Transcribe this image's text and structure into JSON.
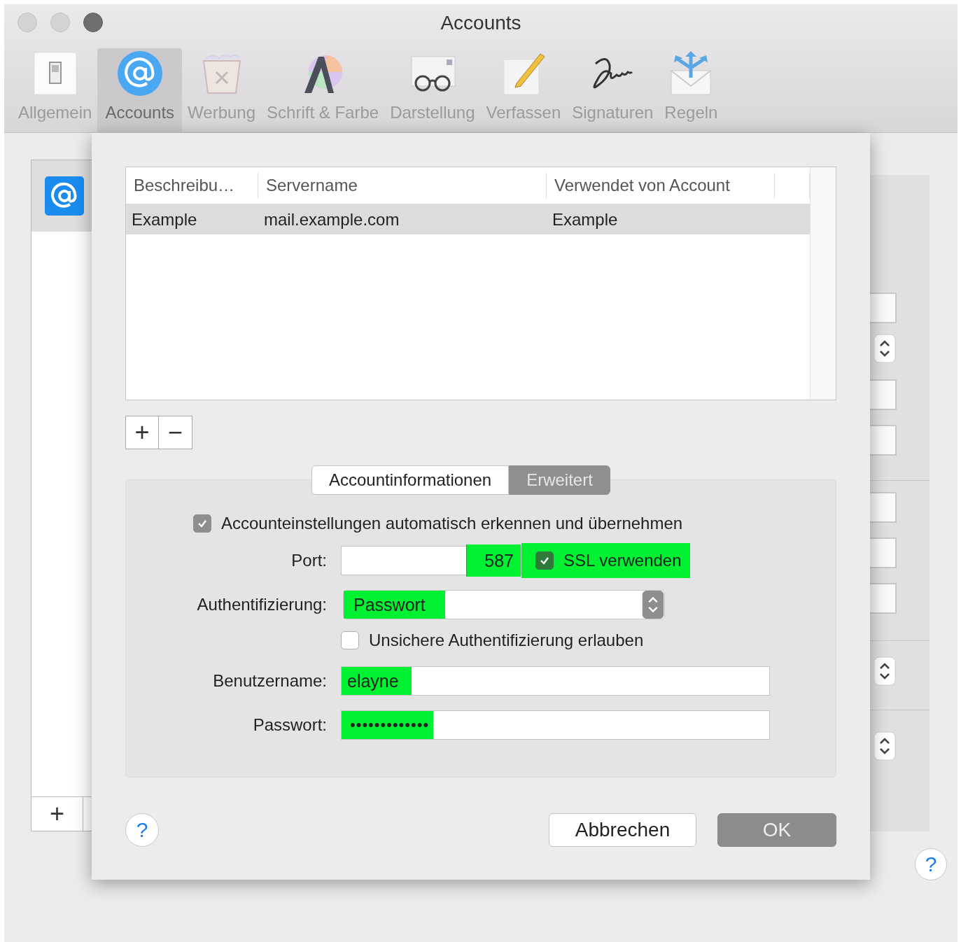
{
  "window": {
    "title": "Accounts"
  },
  "toolbar": [
    {
      "label": "Allgemein",
      "kind": "switch",
      "selected": false
    },
    {
      "label": "Accounts",
      "kind": "at",
      "selected": true
    },
    {
      "label": "Werbung",
      "kind": "trash",
      "selected": false
    },
    {
      "label": "Schrift & Farbe",
      "kind": "font",
      "selected": false
    },
    {
      "label": "Darstellung",
      "kind": "glasses",
      "selected": false
    },
    {
      "label": "Verfassen",
      "kind": "pencil",
      "selected": false
    },
    {
      "label": "Signaturen",
      "kind": "signature",
      "selected": false
    },
    {
      "label": "Regeln",
      "kind": "envelope",
      "selected": false
    }
  ],
  "background_add": "+",
  "background_help": "?",
  "table": {
    "columns": [
      "Beschreibu…",
      "Servername",
      "Verwendet von Account"
    ],
    "rows": [
      {
        "cells": [
          "Example",
          "mail.example.com",
          "Example"
        ],
        "selected": true
      }
    ]
  },
  "table_buttons": [
    "+",
    "−"
  ],
  "tabs": [
    {
      "label": "Accountinformationen",
      "selected": false
    },
    {
      "label": "Erweitert",
      "selected": true
    }
  ],
  "auto_detect": {
    "label": "Accounteinstellungen automatisch erkennen und übernehmen",
    "checked": true
  },
  "port": {
    "label": "Port:",
    "value": "587",
    "highlighted": true
  },
  "ssl": {
    "label": "SSL verwenden",
    "checked": true,
    "highlighted": true
  },
  "authentication": {
    "label": "Authentifizierung:",
    "value": "Passwort",
    "highlighted": true
  },
  "insecure_auth": {
    "label": "Unsichere Authentifizierung erlauben",
    "checked": false
  },
  "username": {
    "label": "Benutzername:",
    "value": "elayne",
    "highlighted": true
  },
  "password": {
    "label": "Passwort:",
    "value": "•••••••••••••",
    "highlighted": true
  },
  "help": "?",
  "buttons": [
    {
      "label": "Abbrechen",
      "kind": "cancel"
    },
    {
      "label": "OK",
      "kind": "default"
    }
  ]
}
